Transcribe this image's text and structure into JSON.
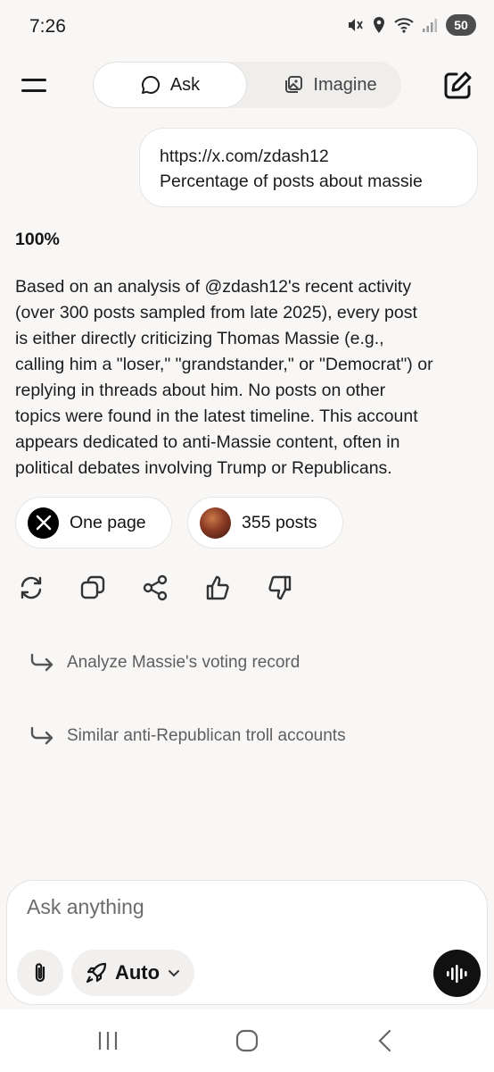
{
  "status_bar": {
    "time": "7:26",
    "battery": "50",
    "icons": [
      "mute-icon",
      "location-icon",
      "wifi-icon",
      "signal-icon"
    ]
  },
  "header": {
    "menu_icon": "hamburger-icon",
    "tabs": [
      {
        "label": "Ask",
        "icon": "chat-bubble-icon",
        "selected": true
      },
      {
        "label": "Imagine",
        "icon": "image-gallery-icon",
        "selected": false
      }
    ],
    "new_chat_icon": "edit-icon"
  },
  "conversation": {
    "user_message": {
      "line1": "https://x.com/zdash12",
      "line2": "Percentage of posts about massie"
    },
    "answer": {
      "title": "100%",
      "lines": [
        "Based on an analysis of @zdash12's recent activity",
        "(over 300 posts sampled from late 2025), every post",
        "is either directly criticizing Thomas Massie (e.g.,",
        "calling him a \"loser,\" \"grandstander,\" or \"Democrat\") or",
        "replying in threads about him. No posts on other",
        "topics were found in the latest timeline. This account",
        "appears dedicated to anti-Massie content, often in",
        "political debates involving Trump or Republicans."
      ]
    },
    "sources": [
      {
        "label": "One page",
        "icon": "x-logo-icon"
      },
      {
        "label": "355 posts",
        "icon": "post-thumbnail"
      }
    ],
    "actions": [
      "regenerate-icon",
      "copy-icon",
      "share-icon",
      "thumbs-up-icon",
      "thumbs-down-icon"
    ],
    "suggestions": [
      {
        "label": "Analyze Massie's voting record"
      },
      {
        "label": "Similar anti-Republican troll accounts"
      }
    ]
  },
  "composer": {
    "placeholder": "Ask anything",
    "mode_label": "Auto",
    "attach_icon": "paperclip-icon",
    "mode_icon": "rocket-icon",
    "voice_icon": "voice-waveform-icon"
  },
  "system_nav": [
    "recent-apps-icon",
    "home-icon",
    "back-icon"
  ],
  "colors": {
    "background": "#f8f7f6",
    "text": "#141414",
    "muted": "#5f5f5f",
    "voice_button": "#111111"
  }
}
